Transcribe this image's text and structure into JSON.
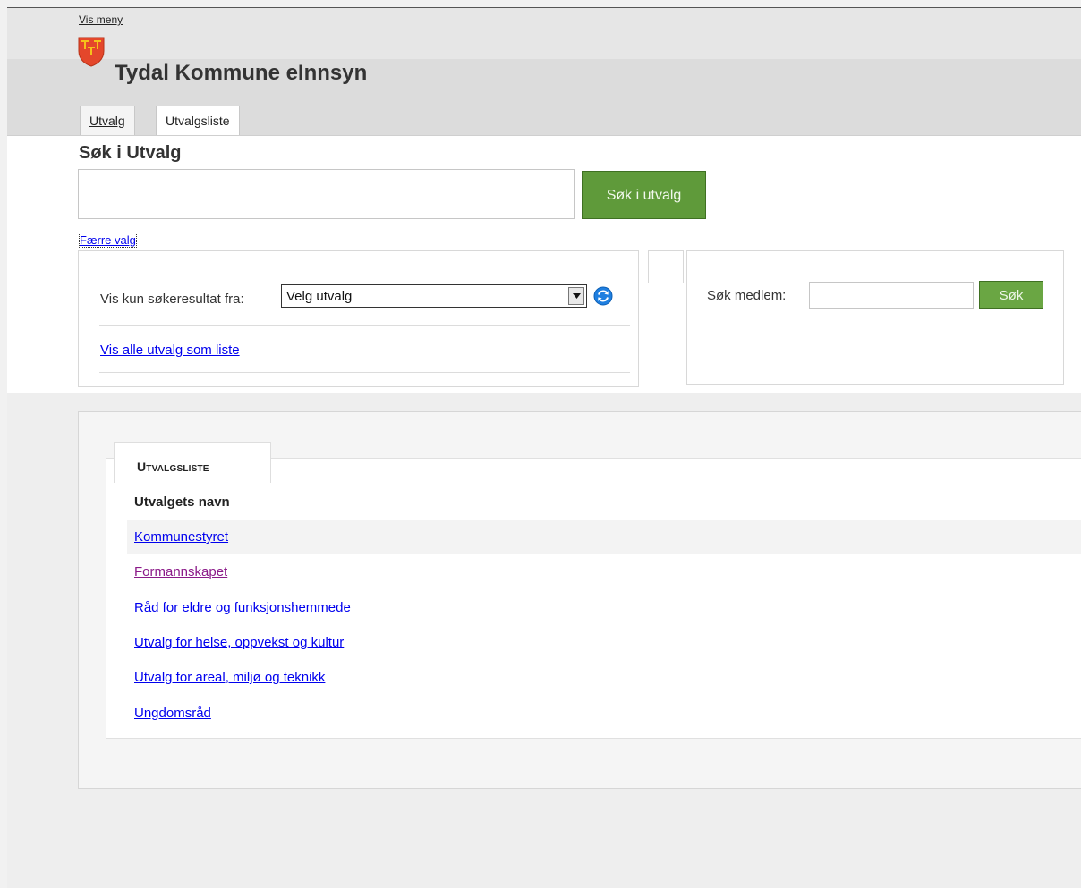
{
  "header": {
    "vis_meny": "Vis meny",
    "site_title": "Tydal Kommune eInnsyn",
    "tabs": [
      {
        "label": "Utvalg"
      },
      {
        "label": "Utvalgsliste"
      }
    ]
  },
  "search": {
    "heading": "Søk i Utvalg",
    "input_value": "",
    "button_label": "Søk i utvalg",
    "faerre_valg": "Færre valg"
  },
  "filter": {
    "label": "Vis kun søkeresultat fra:",
    "selected": "Velg utvalg",
    "vis_alle_link": "Vis alle utvalg som liste"
  },
  "medlem": {
    "label": "Søk medlem:",
    "input_value": "",
    "button_label": "Søk"
  },
  "utvalgsliste": {
    "tab_label": "Utvalgsliste",
    "column_header": "Utvalgets navn",
    "rows": [
      {
        "name": "Kommunestyret",
        "visited": false
      },
      {
        "name": "Formannskapet",
        "visited": true
      },
      {
        "name": "Råd for eldre og funksjonshemmede",
        "visited": false
      },
      {
        "name": "Utvalg for helse, oppvekst og kultur",
        "visited": false
      },
      {
        "name": "Utvalg for areal, miljø og teknikk",
        "visited": false
      },
      {
        "name": "Ungdomsråd",
        "visited": false
      }
    ]
  },
  "colors": {
    "accent_green": "#5f9a3a",
    "link": "#0000ee",
    "visited_link": "#8b1a89",
    "logo_red": "#e4472b",
    "logo_gold": "#f5c21b"
  },
  "icons": [
    "coat-of-arms-icon",
    "chevron-down-icon",
    "refresh-icon"
  ]
}
